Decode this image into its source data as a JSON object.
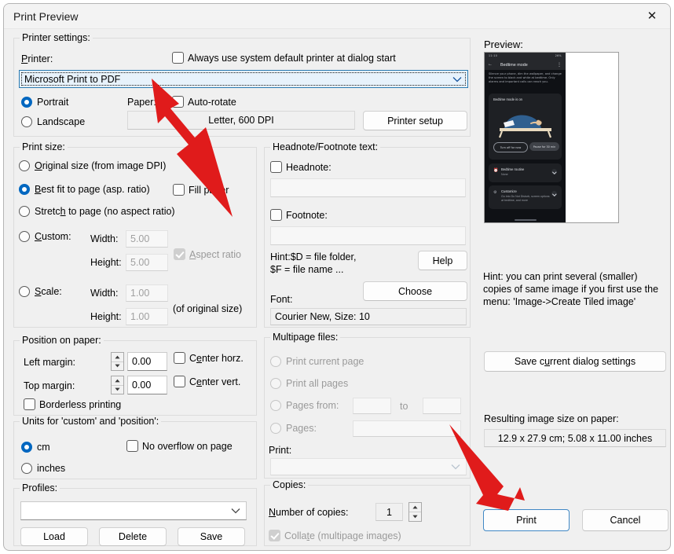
{
  "window": {
    "title": "Print Preview",
    "close_icon": "close-icon"
  },
  "printer_settings": {
    "legend": "Printer settings:",
    "printer_label": "Printer:",
    "always_default_label": "Always use system default printer at dialog start",
    "always_default_checked": false,
    "printer_value": "Microsoft Print to PDF",
    "orientation": {
      "portrait": "Portrait",
      "landscape": "Landscape",
      "selected": "Portrait"
    },
    "paper_label": "Paper:",
    "auto_rotate_label": "Auto-rotate",
    "auto_rotate_checked": false,
    "paper_value": "Letter,   600 DPI",
    "printer_setup_button": "Printer setup"
  },
  "print_size": {
    "legend": "Print size:",
    "options": [
      {
        "label": "Original size (from image DPI)",
        "selected": false
      },
      {
        "label": "Best fit to page (asp. ratio)",
        "selected": true
      },
      {
        "label": "Stretch to page (no aspect ratio)",
        "selected": false
      },
      {
        "label": "Custom:",
        "selected": false
      },
      {
        "label": "Scale:",
        "selected": false
      }
    ],
    "fill_paper_label": "Fill paper",
    "fill_paper_checked": false,
    "aspect_ratio_label": "Aspect ratio",
    "aspect_ratio_checked": true,
    "width_label": "Width:",
    "height_label": "Height:",
    "custom_width": "5.00",
    "custom_height": "5.00",
    "scale_width": "1.00",
    "scale_height": "1.00",
    "of_original_label": "(of original size)"
  },
  "headnote": {
    "legend": "Headnote/Footnote text:",
    "headnote_label": "Headnote:",
    "headnote_checked": false,
    "headnote_value": "",
    "footnote_label": "Footnote:",
    "footnote_checked": false,
    "footnote_value": "",
    "hint_line1": "Hint:$D = file folder,",
    "hint_line2": "$F = file name ...",
    "help_button": "Help",
    "font_label": "Font:",
    "choose_button": "Choose",
    "font_value": "Courier New, Size: 10"
  },
  "position": {
    "legend": "Position on paper:",
    "left_margin_label": "Left margin:",
    "left_margin_value": "0.00",
    "top_margin_label": "Top margin:",
    "top_margin_value": "0.00",
    "center_horz_label": "Center horz.",
    "center_horz_checked": false,
    "center_vert_label": "Center vert.",
    "center_vert_checked": false,
    "borderless_label": "Borderless printing",
    "borderless_checked": false
  },
  "units": {
    "legend": "Units for 'custom' and 'position':",
    "cm_label": "cm",
    "inches_label": "inches",
    "selected": "cm",
    "no_overflow_label": "No overflow on page",
    "no_overflow_checked": false
  },
  "multipage": {
    "legend": "Multipage files:",
    "print_current_label": "Print current page",
    "print_all_label": "Print all pages",
    "pages_from_label": "Pages from:",
    "pages_from_value": "",
    "to_label": "to",
    "pages_to_value": "",
    "pages_label": "Pages:",
    "pages_value": "",
    "print_label": "Print:",
    "print_combo_value": ""
  },
  "profiles": {
    "legend": "Profiles:",
    "combo_value": "",
    "load_button": "Load",
    "delete_button": "Delete",
    "save_button": "Save"
  },
  "copies": {
    "legend": "Copies:",
    "number_label": "Number of copies:",
    "number_value": "1",
    "collate_label": "Collate (multipage images)",
    "collate_checked": true
  },
  "preview": {
    "label": "Preview:",
    "hint": "Hint: you can print several (smaller) copies of same image if you first use the menu: 'Image->Create Tiled image'",
    "save_settings_button": "Save current dialog settings",
    "resulting_label": "Resulting image size on paper:",
    "resulting_value": "12.9 x 27.9 cm; 5.08 x 11.00 inches",
    "image": {
      "status_left": "11:10",
      "status_right": "26%",
      "app_title": "Bedtime mode",
      "back_icon": "back-arrow-icon",
      "menu_icon": "kebab-menu-icon",
      "description": "Silence your phone, dim the wallpaper, and change the screen to black and white at bedtime. Only alarms and important calls can reach you.",
      "card_title": "Bedtime mode is on",
      "btn_turn_off": "Turn off for now",
      "btn_pause": "Pause for 30 min",
      "row1_title": "Bedtime routine",
      "row1_sub": "None",
      "row1_icon": "clock-icon",
      "row2_title": "Customize",
      "row2_sub": "Go into Do Not Disturb, screen options at bedtime, and more",
      "row2_icon": "settings-icon"
    }
  },
  "actions": {
    "print_button": "Print",
    "cancel_button": "Cancel"
  },
  "annotations": {
    "arrow_color": "#e01b1b",
    "arrow1_target": "printer-combo",
    "arrow2_target": "print-button"
  }
}
